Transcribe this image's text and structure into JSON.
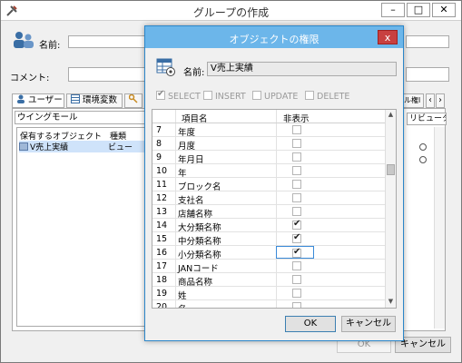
{
  "main": {
    "title": "グループの作成",
    "name_label": "名前:",
    "comment_label": "コメント:",
    "tabs": [
      {
        "label": "ユーザー",
        "icon": "user-icon"
      },
      {
        "label": "環境変数",
        "icon": "table-icon"
      },
      {
        "label": "",
        "icon": "key-icon"
      },
      {
        "label": "ル権l",
        "icon": ""
      }
    ],
    "tab_nav_prev": "‹",
    "tab_nav_next": "›",
    "object_combo": "ウイングモール",
    "object_list_headers": [
      "保有するオブジェクト",
      "種類"
    ],
    "object_list_rows": [
      {
        "name": "V売上実績",
        "type": "ビュー"
      }
    ],
    "attr_column_header": "リビューター",
    "ok_label": "OK",
    "cancel_label": "キャンセル"
  },
  "dialog": {
    "title": "オブジェクトの権限",
    "close_label": "x",
    "name_label": "名前:",
    "name_value": "V売上実績",
    "permissions": [
      {
        "label": "SELECT",
        "checked": true
      },
      {
        "label": "INSERT",
        "checked": false
      },
      {
        "label": "UPDATE",
        "checked": false
      },
      {
        "label": "DELETE",
        "checked": false
      }
    ],
    "grid_headers": {
      "item": "項目名",
      "hidden": "非表示"
    },
    "rows": [
      {
        "num": "7",
        "name": "年度",
        "hidden": false
      },
      {
        "num": "8",
        "name": "月度",
        "hidden": false
      },
      {
        "num": "9",
        "name": "年月日",
        "hidden": false
      },
      {
        "num": "10",
        "name": "年",
        "hidden": false
      },
      {
        "num": "11",
        "name": "ブロック名",
        "hidden": false
      },
      {
        "num": "12",
        "name": "支社名",
        "hidden": false
      },
      {
        "num": "13",
        "name": "店舗名称",
        "hidden": false
      },
      {
        "num": "14",
        "name": "大分類名称",
        "hidden": true
      },
      {
        "num": "15",
        "name": "中分類名称",
        "hidden": true
      },
      {
        "num": "16",
        "name": "小分類名称",
        "hidden": true,
        "selected": true
      },
      {
        "num": "17",
        "name": "JANコード",
        "hidden": false
      },
      {
        "num": "18",
        "name": "商品名称",
        "hidden": false
      },
      {
        "num": "19",
        "name": "姓",
        "hidden": false
      },
      {
        "num": "20",
        "name": "名",
        "hidden": false
      }
    ],
    "ok_label": "OK",
    "cancel_label": "キャンセル"
  },
  "colors": {
    "dialog_title_bg": "#6cb6ea",
    "close_button": "#c84040",
    "selection": "#cfe3fa"
  }
}
